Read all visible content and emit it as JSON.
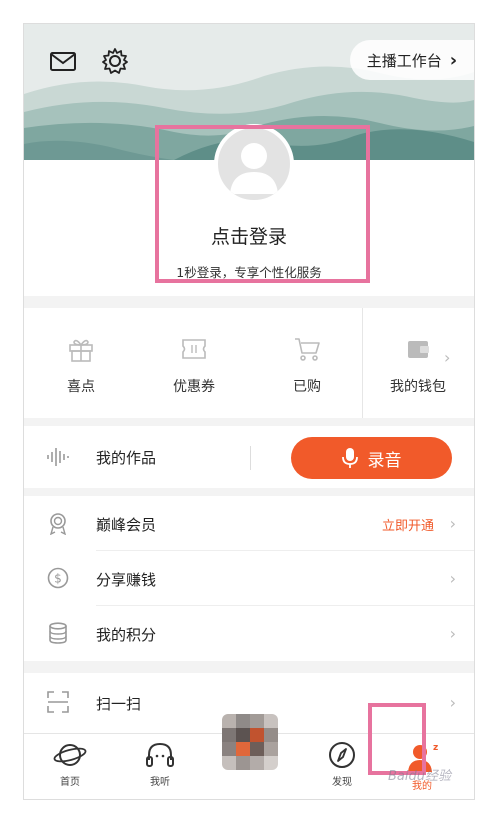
{
  "header": {
    "studio_label": "主播工作台",
    "chevron": "›"
  },
  "profile": {
    "login_title": "点击登录",
    "login_subtitle": "1秒登录，专享个性化服务"
  },
  "quick_actions": [
    {
      "label": "喜点",
      "icon": "gift-icon"
    },
    {
      "label": "优惠券",
      "icon": "coupon-icon"
    },
    {
      "label": "已购",
      "icon": "cart-icon"
    },
    {
      "label": "我的钱包",
      "icon": "wallet-icon"
    }
  ],
  "works": {
    "label": "我的作品",
    "record_label": "录音"
  },
  "menu": {
    "vip": {
      "label": "巅峰会员",
      "action": "立即开通"
    },
    "share": {
      "label": "分享赚钱"
    },
    "points": {
      "label": "我的积分"
    },
    "scan": {
      "label": "扫一扫"
    }
  },
  "tabbar": {
    "home": "首页",
    "listen": "我听",
    "discover": "发现",
    "mine": "我的"
  },
  "watermark": "Baidu经验",
  "colors": {
    "accent": "#f15a2a",
    "highlight": "#e7739e"
  }
}
